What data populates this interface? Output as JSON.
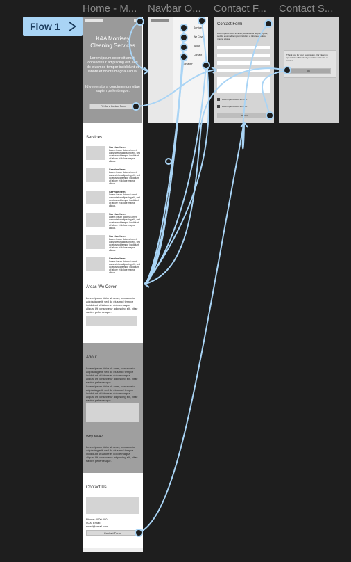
{
  "flow": {
    "label": "Flow 1"
  },
  "frames": {
    "home": {
      "title": "Home - M..."
    },
    "navbar": {
      "title": "Navbar O..."
    },
    "contact_form": {
      "title": "Contact F..."
    },
    "contact_success": {
      "title": "Contact S..."
    }
  },
  "home": {
    "brand": "K&A Morrisey Cleaning Services",
    "hero_para": "Lorem ipsum dolor sit amet, consectetur adipiscing elit, sed do eiusmod tempor incididunt ut labore et dolore magna aliqua.",
    "hero_para2": "Id venenatis a condimentum vitae sapien pellentesque.",
    "hero_button": "Fill Out a Contact Form",
    "services_title": "Services",
    "service_item_title": "Service Item",
    "service_item_text": "Lorem ipsum dolor sit amet, consectetur adipiscing elit, sed do eiusmod tempor incididunt ut labore et dolore magna aliqua.",
    "areas_title": "Areas We Cover",
    "areas_text": "Lorem ipsum dolor sit amet, consectetur adipiscing elit, sed do eiusmod tempor incididunt ut labore et dolore magna aliqua. Ut consectetur adipiscing elit, vitae sapien pellentesque.",
    "about_title": "About",
    "about_text": "Lorem ipsum dolor sit amet, consectetur adipiscing elit, sed do eiusmod tempor incididunt ut labore et dolore magna aliqua. Ut consectetur adipiscing elit, vitae sapien pellentesque.",
    "why_title": "Why K&A?",
    "why_text": "Lorem ipsum dolor sit amet, consectetur adipiscing elit, sed do eiusmod tempor incididunt ut labore et dolore magna aliqua. Ut consectetur adipiscing elit, vitae sapien pellentesque.",
    "contact_title": "Contact Us",
    "contact_details": "Phone: 0000 000 0000 Email: email@email.com",
    "contact_button": "Contact Form"
  },
  "navbar": {
    "items": [
      "Services",
      "We Cover",
      "About",
      "Contact",
      "Contact F"
    ]
  },
  "contact_form": {
    "title": "Contact Form",
    "intro": "Lorem ipsum dolor sit amet, consectetur adipiscing elit, sed do eiusmod tempor incididunt ut labore et dolore magna aliqua.",
    "check1": "Lorem ipsum dolor sit amet",
    "check2": "Lorem ipsum dolor sit amet",
    "submit": "Submit"
  },
  "contact_success": {
    "message": "Thank you for your submission. Our cleaning specialists will contact you within 24 hours of contact.",
    "ok": "OK"
  },
  "colors": {
    "link": "#a9d4f5",
    "canvas": "#1e1e1e",
    "hero": "#9a9a9a"
  }
}
